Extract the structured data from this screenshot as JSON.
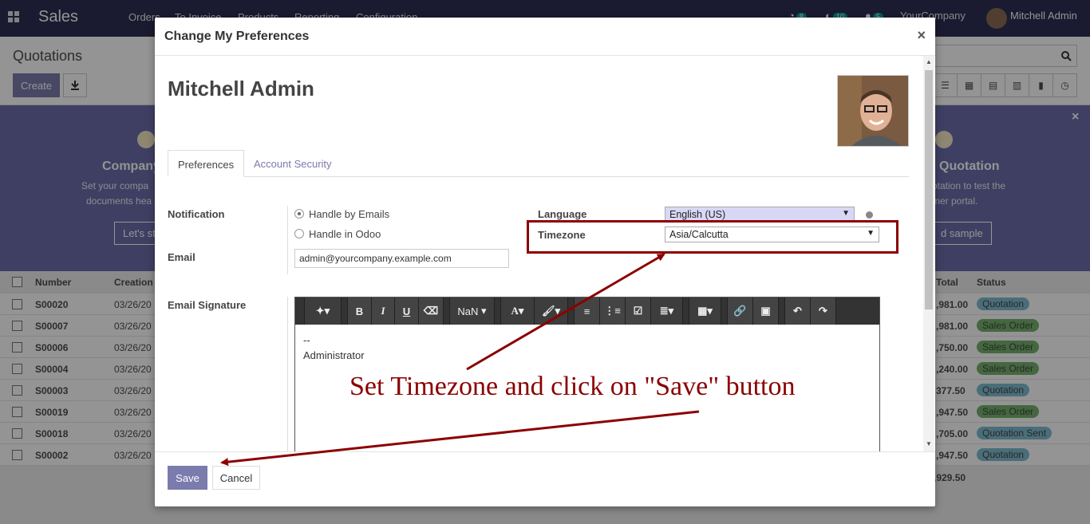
{
  "app": {
    "brand": "Sales",
    "menu": [
      "Orders",
      "To Invoice",
      "Products",
      "Reporting",
      "Configuration"
    ],
    "activity_count": "8",
    "messages_count": "10",
    "chat_count": "5",
    "company": "YourCompany",
    "user": "Mitchell Admin"
  },
  "control_panel": {
    "breadcrumb": "Quotations",
    "create_label": "Create"
  },
  "banner": {
    "left_title": "Company",
    "left_desc_1": "Set your compa",
    "left_desc_2": "documents hea",
    "left_button": "Let's st",
    "right_title": "Quotation",
    "right_desc_1": "otation to test the",
    "right_desc_2": "mer portal.",
    "right_button": "d sample"
  },
  "table": {
    "headers": {
      "number": "Number",
      "creation": "Creation",
      "total": "Total",
      "status": "Status"
    },
    "rows": [
      {
        "number": "S00020",
        "date": "03/26/20",
        "total": ",981.00",
        "status": "Quotation",
        "kind": "q"
      },
      {
        "number": "S00007",
        "date": "03/26/20",
        "total": ",981.00",
        "status": "Sales Order",
        "kind": "s"
      },
      {
        "number": "S00006",
        "date": "03/26/20",
        "total": ",750.00",
        "status": "Sales Order",
        "kind": "s"
      },
      {
        "number": "S00004",
        "date": "03/26/20",
        "total": ",240.00",
        "status": "Sales Order",
        "kind": "s"
      },
      {
        "number": "S00003",
        "date": "03/26/20",
        "total": "377.50",
        "status": "Quotation",
        "kind": "q"
      },
      {
        "number": "S00019",
        "date": "03/26/20",
        "total": ",947.50",
        "status": "Sales Order",
        "kind": "s"
      },
      {
        "number": "S00018",
        "date": "03/26/20",
        "total": ",705.00",
        "status": "Quotation Sent",
        "kind": "q"
      },
      {
        "number": "S00002",
        "date": "03/26/20",
        "total": ",947.50",
        "status": "Quotation",
        "kind": "q"
      }
    ],
    "footer_total": ",929.50"
  },
  "modal": {
    "title": "Change My Preferences",
    "close": "×",
    "user_name": "Mitchell Admin",
    "tabs": [
      "Preferences",
      "Account Security"
    ],
    "notification_label": "Notification",
    "notification_options": [
      "Handle by Emails",
      "Handle in Odoo"
    ],
    "notification_selected": "Handle by Emails",
    "email_label": "Email",
    "email_value": "admin@yourcompany.example.com",
    "language_label": "Language",
    "language_value": "English (US)",
    "timezone_label": "Timezone",
    "timezone_value": "Asia/Calcutta",
    "signature_label": "Email Signature",
    "signature_lines": [
      "--",
      "Administrator"
    ],
    "font_size_label": "NaN",
    "save_label": "Save",
    "cancel_label": "Cancel"
  },
  "annotation": {
    "text": "Set Timezone and click on \"Save\" button",
    "color": "#8b0000"
  },
  "colors": {
    "primary": "#7c7bad",
    "navbar": "#2d2d54",
    "annotation": "#8b0000"
  }
}
